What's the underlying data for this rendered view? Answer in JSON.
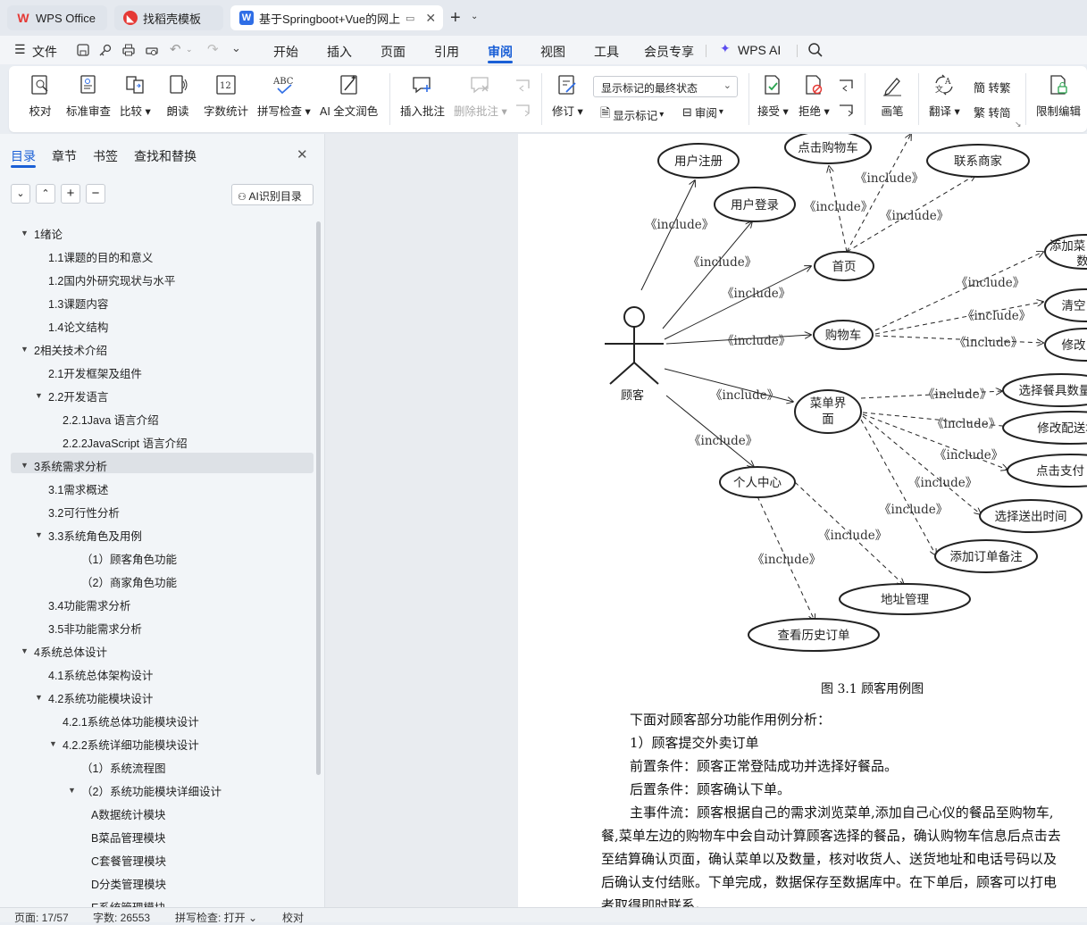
{
  "tabs": [
    {
      "label": "WPS Office",
      "icon": "wps-logo-icon",
      "color": "#e53935"
    },
    {
      "label": "找稻壳模板",
      "icon": "docer-icon",
      "color": "#e53935"
    },
    {
      "label": "基于Springboot+Vue的网上",
      "icon": "word-doc-icon",
      "color": "#2f6ee6"
    }
  ],
  "menu": {
    "file": "文件",
    "items": [
      "开始",
      "插入",
      "页面",
      "引用",
      "审阅",
      "视图",
      "工具",
      "会员专享"
    ],
    "active": "审阅",
    "wps_ai": "WPS AI"
  },
  "ribbon": {
    "proofread": "校对",
    "standard_review": "标准审查",
    "compare": "比较",
    "read_aloud": "朗读",
    "word_count": "字数统计",
    "spell_check": "拼写检查",
    "ai_polish": "AI 全文润色",
    "insert_comment": "插入批注",
    "delete_comment": "删除批注",
    "track": "修订",
    "show_mode": "显示标记的最终状态",
    "show_markup": "显示标记",
    "review": "审阅",
    "accept": "接受",
    "reject": "拒绝",
    "pen": "画笔",
    "translate": "翻译",
    "to_traditional": "转繁",
    "to_simplified": "转简",
    "restrict_edit": "限制编辑"
  },
  "sidebar": {
    "tabs": [
      "目录",
      "章节",
      "书签",
      "查找和替换"
    ],
    "ai_toc": "AI识别目录",
    "toc": [
      {
        "text": "1绪论",
        "level": 0,
        "arrow": true
      },
      {
        "text": "1.1课题的目的和意义",
        "level": 1
      },
      {
        "text": "1.2国内外研究现状与水平",
        "level": 1
      },
      {
        "text": "1.3课题内容",
        "level": 1
      },
      {
        "text": "1.4论文结构",
        "level": 1
      },
      {
        "text": "2相关技术介绍",
        "level": 0,
        "arrow": true
      },
      {
        "text": "2.1开发框架及组件",
        "level": 1
      },
      {
        "text": "2.2开发语言",
        "level": 1,
        "arrow": true
      },
      {
        "text": "2.2.1Java 语言介绍",
        "level": 2
      },
      {
        "text": "2.2.2JavaScript 语言介绍",
        "level": 2
      },
      {
        "text": "3系统需求分析",
        "level": 0,
        "arrow": true,
        "selected": true
      },
      {
        "text": "3.1需求概述",
        "level": 1
      },
      {
        "text": "3.2可行性分析",
        "level": 1
      },
      {
        "text": "3.3系统角色及用例",
        "level": 1,
        "arrow": true
      },
      {
        "text": "（1）顾客角色功能",
        "level": 3
      },
      {
        "text": "（2）商家角色功能",
        "level": 3
      },
      {
        "text": "3.4功能需求分析",
        "level": 1
      },
      {
        "text": "3.5非功能需求分析",
        "level": 1
      },
      {
        "text": "4系统总体设计",
        "level": 0,
        "arrow": true
      },
      {
        "text": "4.1系统总体架构设计",
        "level": 1
      },
      {
        "text": "4.2系统功能模块设计",
        "level": 1,
        "arrow": true
      },
      {
        "text": "4.2.1系统总体功能模块设计",
        "level": 2
      },
      {
        "text": "4.2.2系统详细功能模块设计",
        "level": 2,
        "arrow": true
      },
      {
        "text": "（1）系统流程图",
        "level": 3
      },
      {
        "text": "（2）系统功能模块详细设计",
        "level": 3,
        "arrow": true
      },
      {
        "text": "A数据统计模块",
        "level": 4
      },
      {
        "text": "B菜品管理模块",
        "level": 4
      },
      {
        "text": "C套餐管理模块",
        "level": 4
      },
      {
        "text": "D分类管理模块",
        "level": 4
      },
      {
        "text": "E系统管理模块",
        "level": 4
      }
    ]
  },
  "diagram": {
    "actor": "顾客",
    "include": "《include》",
    "nodes": {
      "register": "用户注册",
      "login": "用户登录",
      "cart_click": "点击购物车",
      "contact": "联系商家",
      "home": "首页",
      "add_cart": "添加菜",
      "add_cart2": "数",
      "clear": "清空",
      "modify": "修改",
      "cart": "购物车",
      "menu1": "菜单界",
      "menu2": "面",
      "select_qty": "选择餐具数量",
      "modify_addr": "修改配送地",
      "pay": "点击支付",
      "select_time": "选择送出时间",
      "remark": "添加订单备注",
      "personal": "个人中心",
      "address": "地址管理",
      "history": "查看历史订单"
    },
    "caption": "图 3.1 顾客用例图"
  },
  "body": {
    "p1": "下面对顾客部分功能作用例分析：",
    "p2": "1）顾客提交外卖订单",
    "p3": "前置条件：顾客正常登陆成功并选择好餐品。",
    "p4": "后置条件：顾客确认下单。",
    "p5": "主事件流：顾客根据自己的需求浏览菜单,添加自己心仪的餐品至购物车,",
    "p6": "餐,菜单左边的购物车中会自动计算顾客选择的餐品，确认购物车信息后点击去",
    "p7": "至结算确认页面，确认菜单以及数量，核对收货人、送货地址和电话号码以及",
    "p8": "后确认支付结账。下单完成，数据保存至数据库中。在下单后，顾客可以打电",
    "p9": "者取得即时联系。"
  },
  "status": {
    "page": "页面: 17/57",
    "words": "字数: 26553",
    "spell": "拼写检查: 打开",
    "proof": "校对"
  }
}
